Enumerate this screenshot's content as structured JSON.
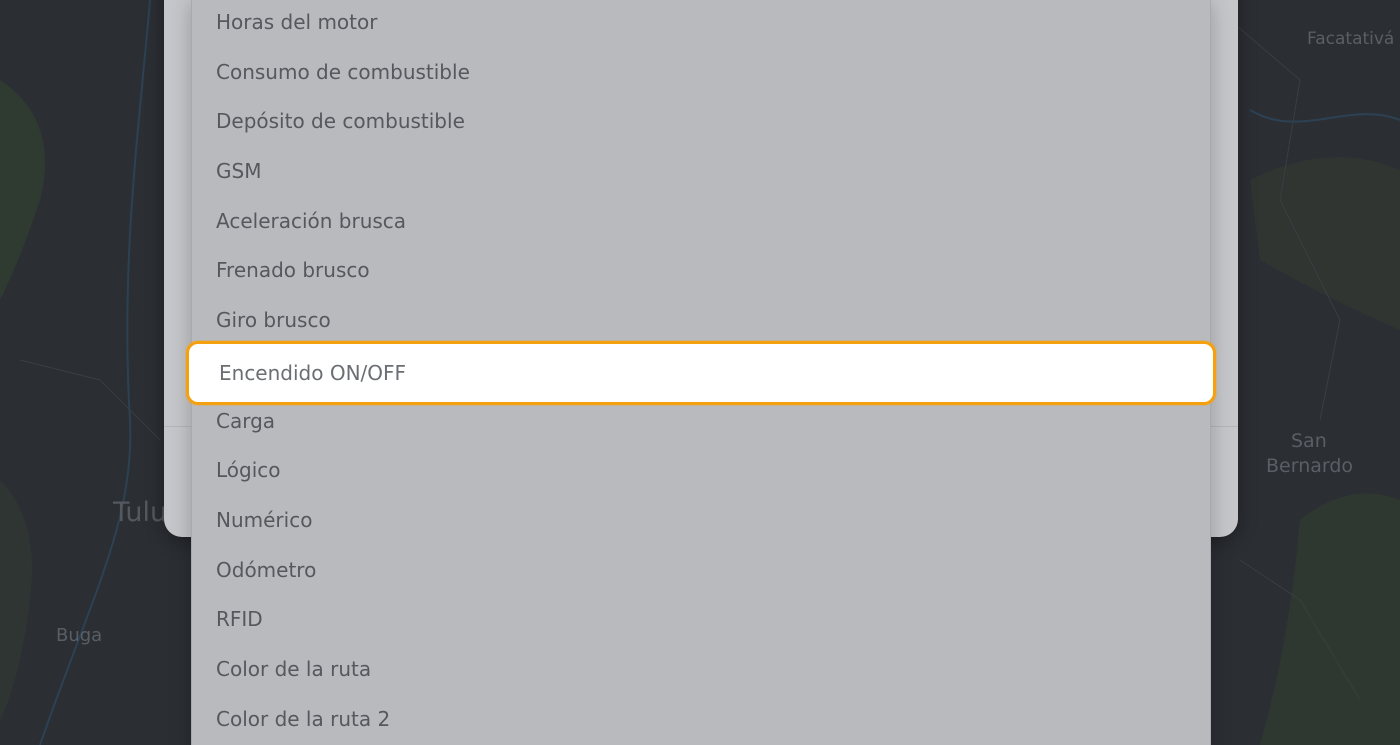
{
  "map": {
    "labels": {
      "facatativa": "Facatativá",
      "san": "San",
      "bernardo": "Bernardo",
      "tulu": "Tulu",
      "buga": "Buga"
    }
  },
  "dropdown": {
    "selected_index": 7,
    "options": [
      "Horas del motor",
      "Consumo de combustible",
      "Depósito de combustible",
      "GSM",
      "Aceleración brusca",
      "Frenado brusco",
      "Giro brusco",
      "Encendido ON/OFF",
      "Carga",
      "Lógico",
      "Numérico",
      "Odómetro",
      "RFID",
      "Color de la ruta",
      "Color de la ruta 2"
    ]
  },
  "colors": {
    "highlight_border": "#f5a10f",
    "dropdown_bg": "#b9babd",
    "map_bg": "#2b2e33"
  }
}
